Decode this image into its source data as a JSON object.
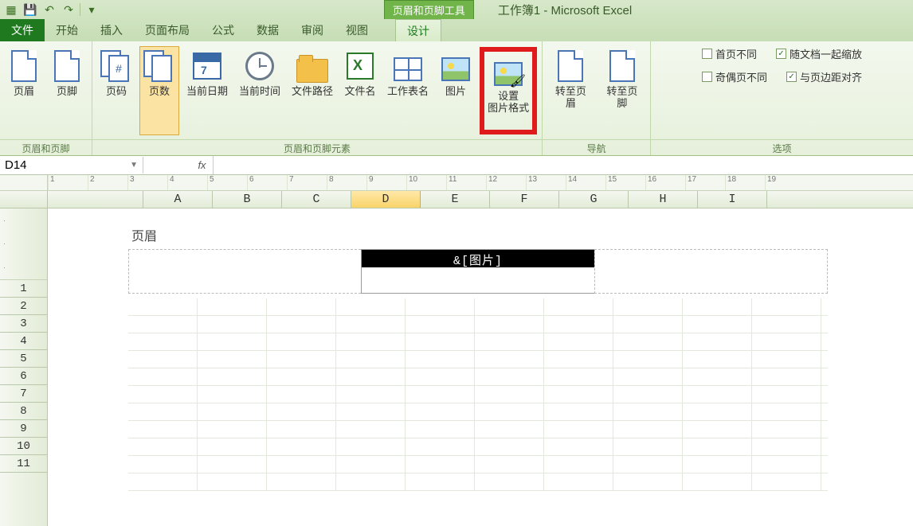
{
  "titlebar": {
    "context_tool_label": "页眉和页脚工具",
    "app_title": "工作簿1 - Microsoft Excel"
  },
  "tabs": {
    "file": "文件",
    "items": [
      "开始",
      "插入",
      "页面布局",
      "公式",
      "数据",
      "审阅",
      "视图"
    ],
    "contextual": "设计"
  },
  "ribbon": {
    "group_hf": {
      "label": "页眉和页脚",
      "header": "页眉",
      "footer": "页脚"
    },
    "group_elements": {
      "label": "页眉和页脚元素",
      "page_number": "页码",
      "page_count": "页数",
      "current_date": "当前日期",
      "current_time": "当前时间",
      "file_path": "文件路径",
      "file_name": "文件名",
      "sheet_name": "工作表名",
      "picture": "图片",
      "format_picture_l1": "设置",
      "format_picture_l2": "图片格式"
    },
    "group_nav": {
      "label": "导航",
      "goto_header": "转至页眉",
      "goto_footer": "转至页脚"
    },
    "group_options": {
      "label": "选项",
      "diff_first": "首页不同",
      "scale_doc": "随文档一起缩放",
      "diff_oddeven": "奇偶页不同",
      "align_margins": "与页边距对齐",
      "checked_scale": true,
      "checked_align": true
    }
  },
  "formula_bar": {
    "name_box": "D14",
    "fx": "fx"
  },
  "columns": [
    "A",
    "B",
    "C",
    "D",
    "E",
    "F",
    "G",
    "H",
    "I"
  ],
  "active_col_index": 3,
  "rows": [
    1,
    2,
    3,
    4,
    5,
    6,
    7,
    8,
    9,
    10,
    11
  ],
  "header_edit": {
    "section_label": "页眉",
    "center_code": "&[图片]"
  },
  "ruler_marks": [
    "1",
    "2",
    "3",
    "4",
    "5",
    "6",
    "7",
    "8",
    "9",
    "10",
    "11",
    "12",
    "13",
    "14",
    "15",
    "16",
    "17",
    "18",
    "19"
  ]
}
